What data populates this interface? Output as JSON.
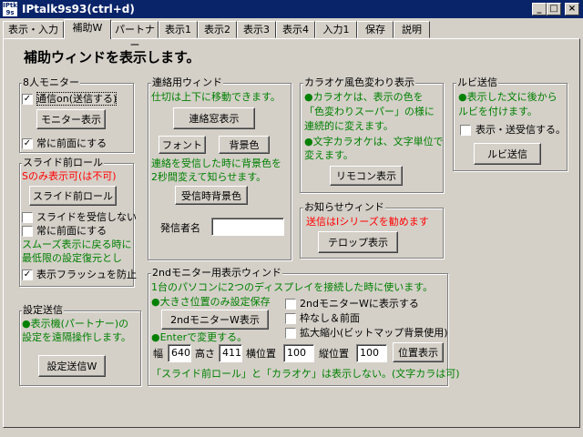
{
  "window": {
    "title": "IPtalk9s93(ctrl+d)",
    "icon_text": "IPtk 9s",
    "min": "_",
    "max": "□",
    "close": "×"
  },
  "tabs": [
    "表示・入力",
    "補助W",
    "パートナー",
    "表示1",
    "表示2",
    "表示3",
    "表示4",
    "入力1",
    "保存",
    "説明"
  ],
  "heading": "補助ウィンドを表示します。",
  "monitor8": {
    "legend": "8人モニター",
    "check_comm": "通信on(送信する)",
    "monitor_button": "モニター表示",
    "check_front": "常に前面にする",
    "check_comm_value": "✓",
    "check_front_value": "✓"
  },
  "slide": {
    "legend": "スライド前ロール",
    "note": "Sのみ表示可(は不可)",
    "button": "スライド前ロール",
    "check_noreceive": "スライドを受信しない",
    "check_front": "常に前面にする",
    "green1": "スムーズ表示に戻る時に",
    "green2": "最低限の設定復元とし",
    "check_flash": "表示フラッシュを防止",
    "check_flash_value": "✓"
  },
  "settings_send": {
    "legend": "設定送信",
    "green1": "●表示機(パートナー)の",
    "green2": "設定を遠隔操作します。",
    "button": "設定送信W"
  },
  "contact": {
    "legend": "連絡用ウィンド",
    "green1": "仕切は上下に移動できます。",
    "show_button": "連絡窓表示",
    "font_button": "フォント",
    "bg_button": "背景色",
    "green2": "連絡を受信した時に背景色を",
    "green3": "2秒間変えて知らせます。",
    "recv_bg_button": "受信時背景色",
    "sender_label": "発信者名",
    "sender_value": ""
  },
  "karaoke": {
    "legend": "カラオケ風色変わり表示",
    "lines": [
      "●カラオケは、表示の色を",
      "「色変わりスーパー」の様に",
      "連続的に変えます。",
      "●文字カラオケは、文字単位で",
      "変えます。"
    ],
    "button": "リモコン表示"
  },
  "notice": {
    "legend": "お知らせウィンド",
    "red": "送信はIシリーズを勧めます",
    "button": "テロップ表示"
  },
  "ruby": {
    "legend": "ルビ送信",
    "green1": "●表示した文に後から",
    "green2": "ルビを付けます。",
    "check": "表示・送受信する。",
    "button": "ルビ送信"
  },
  "monitor2": {
    "legend": "2ndモニター用表示ウィンド",
    "green1": "1台のパソコンに2つのディスプレイを接続した時に使います。",
    "green2": "●大きさ位置のみ設定保存",
    "button": "2ndモニターW表示",
    "green3": "●Enterで変更する。",
    "check1": "2ndモニターWに表示する",
    "check2": "枠なし＆前面",
    "check3": "拡大縮小(ビットマップ背景使用)",
    "width_label": "幅",
    "width_value": "640",
    "height_label": "高さ",
    "height_value": "411",
    "xpos_label": "横位置",
    "xpos_value": "100",
    "ypos_label": "縦位置",
    "ypos_value": "100",
    "pos_button": "位置表示",
    "footer": "「スライド前ロール」と「カラオケ」は表示しない。(文字カラは可)"
  }
}
